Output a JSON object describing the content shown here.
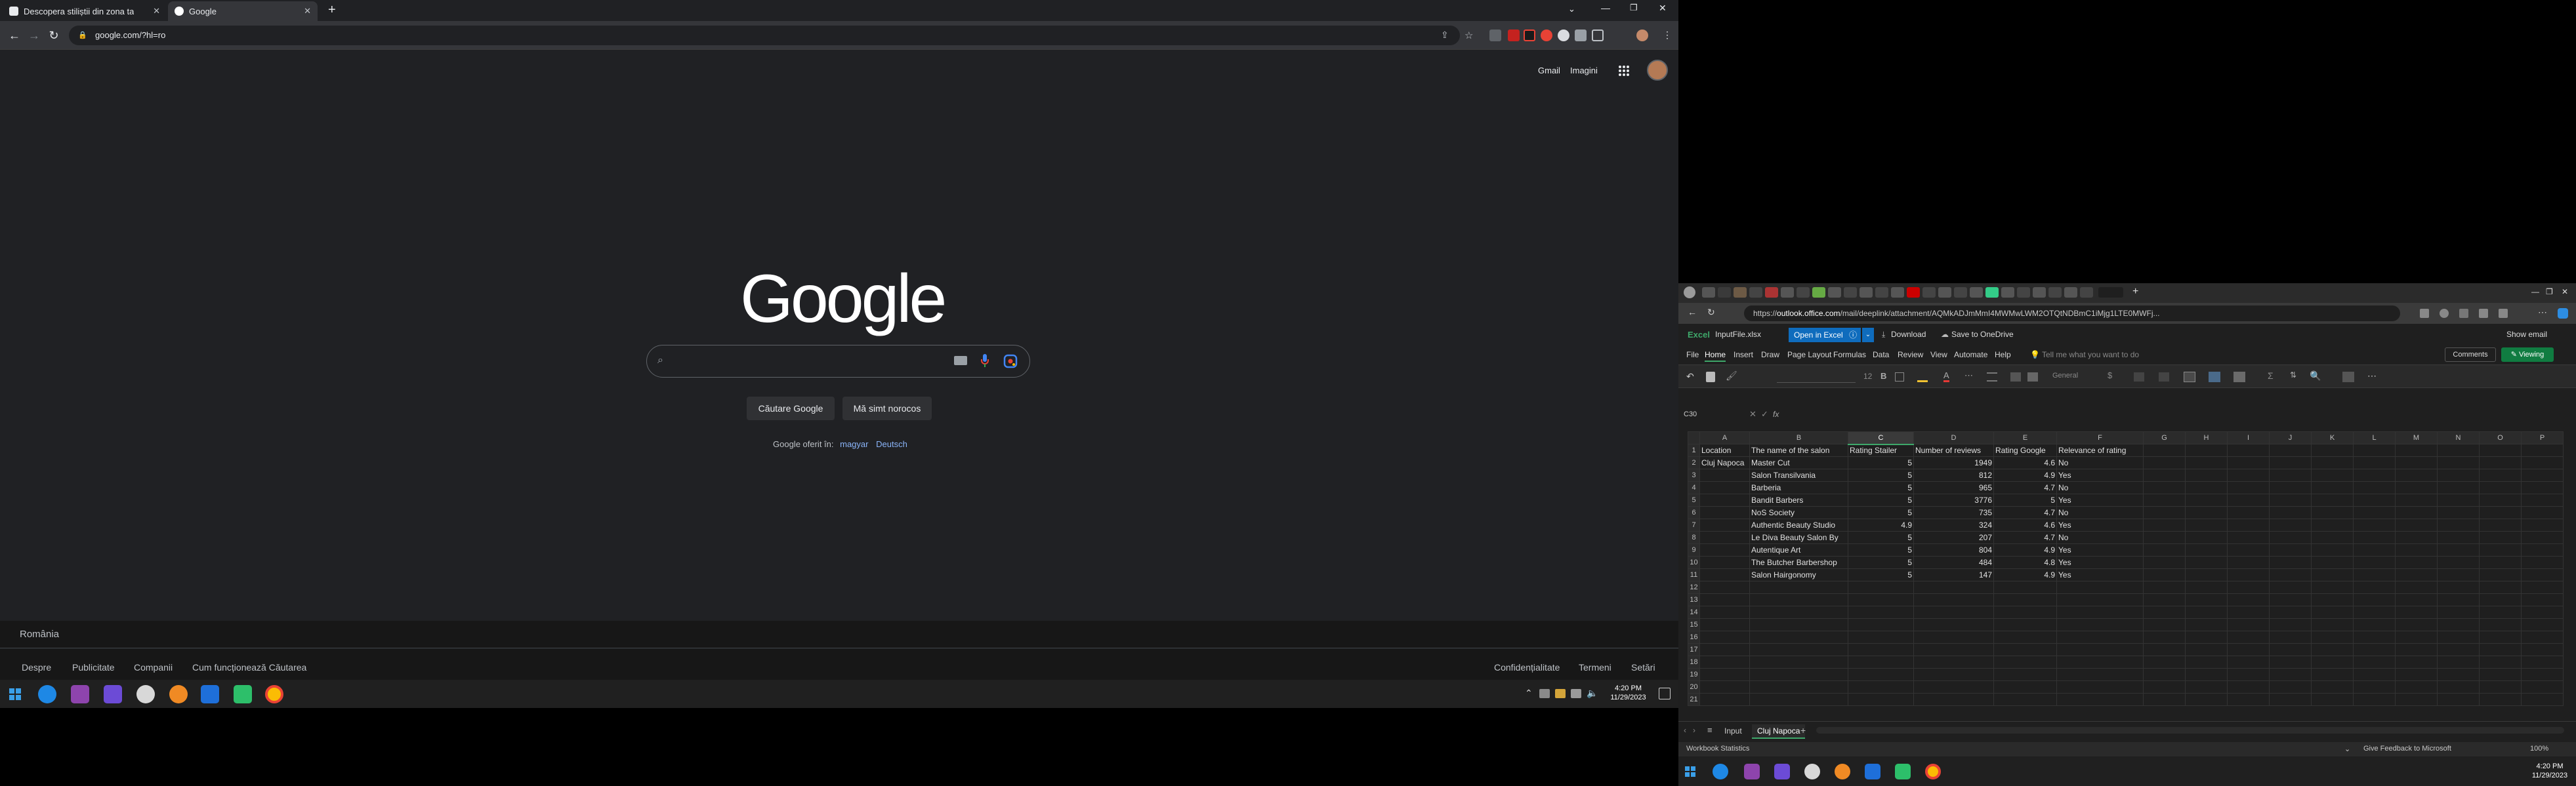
{
  "left_window": {
    "tabs": [
      {
        "label": "Descopera stiliștii din zona ta",
        "favicon_color": "#e8eaed"
      },
      {
        "label": "Google",
        "favicon_color": "#ea4335"
      }
    ],
    "address": "google.com/?hl=ro",
    "header_links": {
      "gmail": "Gmail",
      "images": "Imagini"
    },
    "logo": "Google",
    "buttons": {
      "search": "Căutare Google",
      "lucky": "Mă simt norocos"
    },
    "offered_in": {
      "label": "Google oferit în:",
      "lang1": "magyar",
      "lang2": "Deutsch"
    },
    "country": "România",
    "footer_links_left": [
      "Despre",
      "Publicitate",
      "Companii",
      "Cum funcționează Căutarea"
    ],
    "footer_links_right": [
      "Confidențialitate",
      "Termeni",
      "Setări"
    ],
    "clock": {
      "time": "4:20 PM",
      "date": "11/29/2023"
    }
  },
  "right_window": {
    "url_prefix": "https://",
    "url_host": "outlook.office.com",
    "url_rest": "/mail/deeplink/attachment/AQMkADJmMmI4MWMwLWM2OTQtNDBmC1iMjg1LTE0MWFj...",
    "excel": {
      "app": "Excel",
      "file": "InputFile.xlsx",
      "open_in_excel": "Open in Excel",
      "download": "Download",
      "save": "Save to OneDrive",
      "show_email": "Show email",
      "comments": "Comments",
      "viewing": "Viewing",
      "tell_me": "Tell me what you want to do",
      "ribbon_tabs": [
        "File",
        "Home",
        "Insert",
        "Draw",
        "Page Layout",
        "Formulas",
        "Data",
        "Review",
        "View",
        "Automate",
        "Help"
      ],
      "font_size": "12",
      "number_format": "General",
      "name_box": "C30",
      "fx": "fx",
      "columns": [
        "A",
        "B",
        "C",
        "D",
        "E",
        "F",
        "G",
        "H",
        "I",
        "J",
        "K",
        "L",
        "M",
        "N",
        "O",
        "P"
      ],
      "rows": [
        [
          "Location",
          "The name of the salon",
          "Rating Stailer",
          "Number of reviews",
          "Rating Google",
          "Relevance of rating"
        ],
        [
          "Cluj Napoca",
          "Master Cut",
          "5",
          "1949",
          "4.6",
          "No"
        ],
        [
          "",
          "Salon Transilvania",
          "5",
          "812",
          "4.9",
          "Yes"
        ],
        [
          "",
          "Barberia",
          "5",
          "965",
          "4.7",
          "No"
        ],
        [
          "",
          "Bandit Barbers",
          "5",
          "3776",
          "5",
          "Yes"
        ],
        [
          "",
          "NoS Society",
          "5",
          "735",
          "4.7",
          "No"
        ],
        [
          "",
          "Authentic Beauty Studio",
          "4.9",
          "324",
          "4.6",
          "Yes"
        ],
        [
          "",
          "Le Diva Beauty Salon By",
          "5",
          "207",
          "4.7",
          "No"
        ],
        [
          "",
          "Autentique Art",
          "5",
          "804",
          "4.9",
          "Yes"
        ],
        [
          "",
          "The Butcher Barbershop",
          "5",
          "484",
          "4.8",
          "Yes"
        ],
        [
          "",
          "Salon Hairgonomy",
          "5",
          "147",
          "4.9",
          "Yes"
        ]
      ],
      "empty_rows": [
        12,
        13,
        14,
        15,
        16,
        17,
        18,
        19,
        20,
        21
      ],
      "sheet_tabs": [
        "Input",
        "Cluj Napoca"
      ],
      "status_left": "Workbook Statistics",
      "status_feedback": "Give Feedback to Microsoft",
      "zoom": "100%"
    },
    "clock": {
      "time": "4:20 PM",
      "date": "11/29/2023"
    }
  },
  "colors": {
    "accent_excel": "#107c41",
    "accent_blue": "#0f6cbd",
    "link_blue": "#8ab4f8"
  }
}
